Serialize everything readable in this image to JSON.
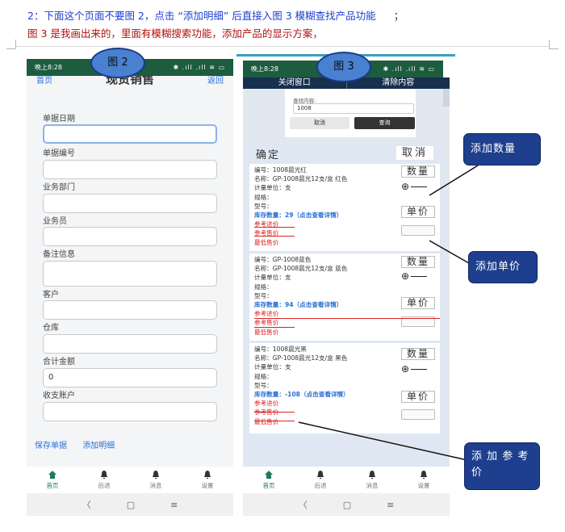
{
  "notes": {
    "line1": "2：下面这个页面不要图 2，点击 “添加明细” 后直接入图 3 模糊查找产品功能",
    "line1_tail": "；",
    "line2": "图 3 是我画出来的，里面有模糊搜索功能，添加产品的显示方案，"
  },
  "phone2": {
    "status_time": "晚上8:28",
    "status_icons": "✱ .ıll .ıll ≋ ▭",
    "header": {
      "back": "首页",
      "title": "现货销售",
      "ret": "返回"
    },
    "fields": [
      {
        "label": "单据日期",
        "value": ""
      },
      {
        "label": "单据编号",
        "value": ""
      },
      {
        "label": "业务部门",
        "value": ""
      },
      {
        "label": "业务员",
        "value": ""
      },
      {
        "label": "备注信息",
        "value": ""
      },
      {
        "label": "客户",
        "value": ""
      },
      {
        "label": "仓库",
        "value": ""
      },
      {
        "label": "合计金额",
        "value": "0"
      },
      {
        "label": "收支账户",
        "value": ""
      }
    ],
    "links": {
      "save": "保存单据",
      "add_detail": "添加明细"
    },
    "nav": [
      "首页",
      "后退",
      "消息",
      "设置"
    ],
    "sysnav": [
      "〈",
      "▢",
      "≡"
    ]
  },
  "phone3": {
    "status_time": "晚上8:28",
    "status_icons": "✱ .ıll .ıll ≋ ▭",
    "topbar": {
      "close": "关闭窗口",
      "clear": "清除内容"
    },
    "search": {
      "label": "查找内容:",
      "value": "1008",
      "cancel": "取消",
      "query": "查询"
    },
    "panel": {
      "ok": "确定",
      "cancel": "取消"
    },
    "products": [
      {
        "code": "编号：1008晨光红",
        "name": "名称：GP-1008晨光12支/盒 红色",
        "unit": "计量单位：支",
        "spec": "规格：",
        "model": "型号：",
        "stock": "库存数量：29（点击查看详情）",
        "ref_in": "参考进价",
        "ref_out": "参考售价",
        "min_price": "最低售价"
      },
      {
        "code": "编号：GP-1008蓝色",
        "name": "名称：GP-1008晨光12支/盒 蓝色",
        "unit": "计量单位：支",
        "spec": "规格：",
        "model": "型号：",
        "stock": "库存数量：94（点击查看详情）",
        "ref_in": "参考进价",
        "ref_out": "参考售价",
        "min_price": "最低售价"
      },
      {
        "code": "编号：1008晨光黑",
        "name": "名称：GP-1008晨光12支/盒 黑色",
        "unit": "计量单位：支",
        "spec": "规格：",
        "model": "型号：",
        "stock": "库存数量：-108（点击查看详情）",
        "ref_in": "参考进价",
        "ref_out": "参考售价",
        "min_price": "最低售价"
      }
    ],
    "qty_label": "数量",
    "qty_symbol": "⊕",
    "price_label": "单价",
    "nav": [
      "首页",
      "后退",
      "消息",
      "设置"
    ],
    "sysnav": [
      "〈",
      "▢",
      "≡"
    ]
  },
  "callouts": {
    "fig2": "图 2",
    "fig3": "图 3",
    "add_qty": "添加数量",
    "add_price": "添加单价",
    "add_ref_price": "添 加 参 考 价"
  },
  "colors": {
    "status_bar": "#1d5c3e",
    "top_bar": "#173050",
    "callout": "#1e3f8e",
    "link": "#2a6fd6",
    "price_red": "#d22222"
  }
}
